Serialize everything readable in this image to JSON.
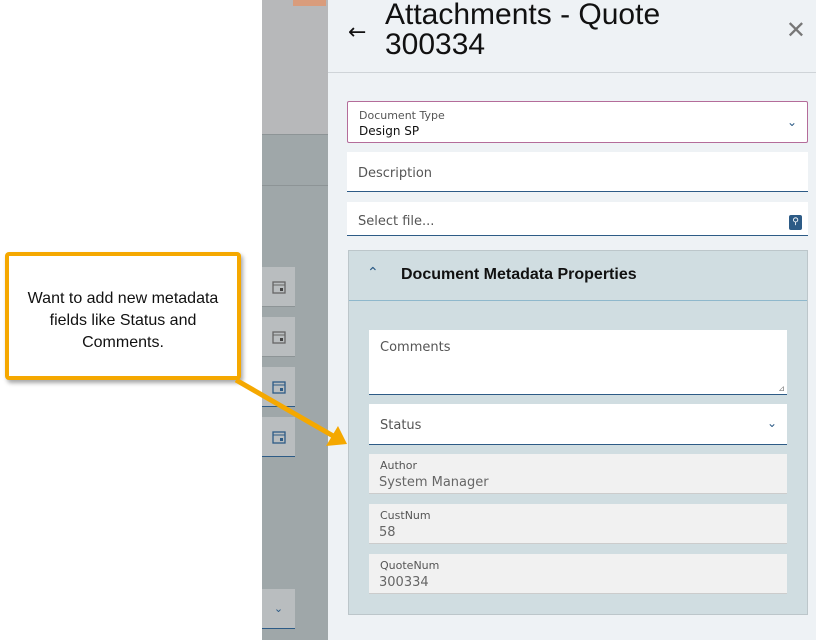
{
  "header": {
    "title": "Attachments - Quote 300334"
  },
  "form": {
    "document_type": {
      "label": "Document Type",
      "value": "Design SP"
    },
    "description": {
      "placeholder": "Description"
    },
    "file": {
      "placeholder": "Select file..."
    }
  },
  "metadata": {
    "title": "Document Metadata Properties",
    "comments": {
      "placeholder": "Comments"
    },
    "status": {
      "placeholder": "Status"
    },
    "readonly": [
      {
        "label": "Author",
        "value": "System Manager"
      },
      {
        "label": "CustNum",
        "value": "58"
      },
      {
        "label": "QuoteNum",
        "value": "300334"
      }
    ]
  },
  "callout": {
    "text": "Want to add new metadata fields like Status and Comments."
  },
  "colors": {
    "accent": "#2d5b86",
    "callout_border": "#f5a800"
  }
}
